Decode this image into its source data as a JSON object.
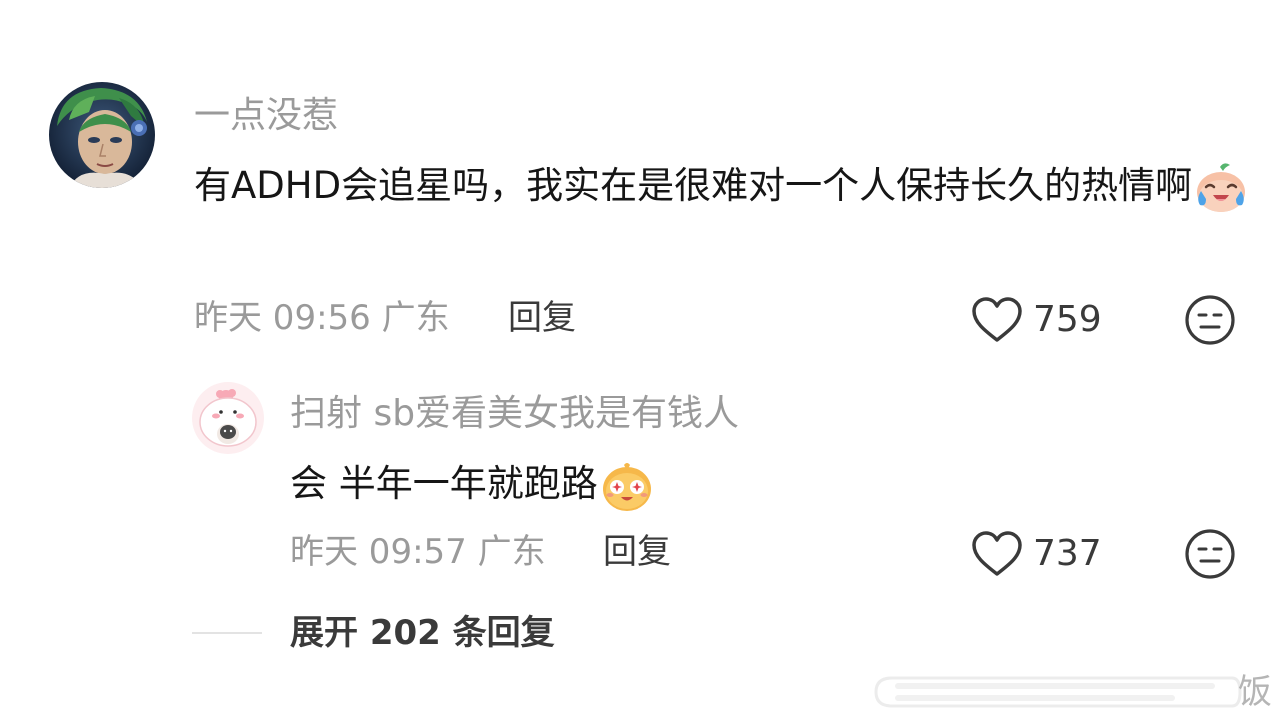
{
  "comment": {
    "username": "一点没惹",
    "text": "有ADHD会追星吗，我实在是很难对一个人保持长久的热情啊",
    "emoji_name": "crying-laughing-emoji",
    "time": "昨天 09:56",
    "location": "广东",
    "reply_label": "回复",
    "like_count": "759"
  },
  "reply": {
    "username": "扫射 sb爱看美女我是有钱人",
    "text": "会 半年一年就跑路",
    "emoji_name": "starry-eyed-emoji",
    "time": "昨天 09:57",
    "location": "广东",
    "reply_label": "回复",
    "like_count": "737"
  },
  "expand_replies": {
    "label": "展开 202 条回复"
  },
  "watermark": {
    "text": "饭"
  },
  "icons": {
    "like": "heart-outline-icon",
    "reaction": "meh-face-icon"
  },
  "colors": {
    "text_primary": "#161616",
    "text_secondary": "#9a9a9a",
    "text_action": "#3a3a3a",
    "divider": "#e3e3e3"
  }
}
